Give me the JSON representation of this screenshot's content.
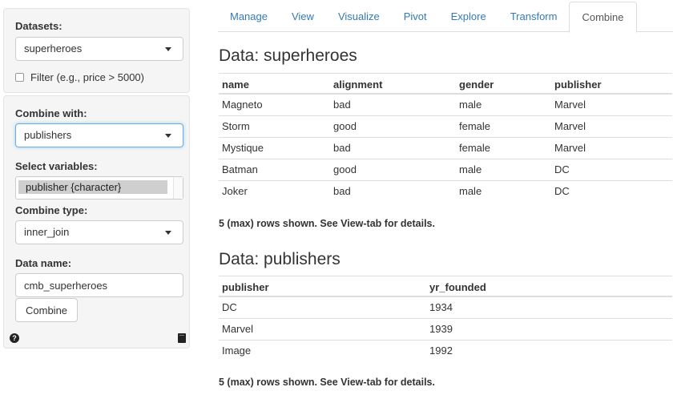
{
  "sidebar": {
    "datasets_label": "Datasets:",
    "dataset_selected": "superheroes",
    "filter_label": "Filter (e.g., price > 5000)",
    "combine_with_label": "Combine with:",
    "combine_with_selected": "publishers",
    "select_variables_label": "Select variables:",
    "variables_options": [
      "publisher {character}"
    ],
    "combine_type_label": "Combine type:",
    "combine_type_selected": "inner_join",
    "data_name_label": "Data name:",
    "data_name_value": "cmb_superheroes",
    "combine_button": "Combine",
    "help_icon_glyph": "?"
  },
  "tabs": [
    {
      "label": "Manage",
      "active": false
    },
    {
      "label": "View",
      "active": false
    },
    {
      "label": "Visualize",
      "active": false
    },
    {
      "label": "Pivot",
      "active": false
    },
    {
      "label": "Explore",
      "active": false
    },
    {
      "label": "Transform",
      "active": false
    },
    {
      "label": "Combine",
      "active": true
    }
  ],
  "main": {
    "table1": {
      "title": "Data: superheroes",
      "columns": [
        "name",
        "alignment",
        "gender",
        "publisher"
      ],
      "rows": [
        [
          "Magneto",
          "bad",
          "male",
          "Marvel"
        ],
        [
          "Storm",
          "good",
          "female",
          "Marvel"
        ],
        [
          "Mystique",
          "bad",
          "female",
          "Marvel"
        ],
        [
          "Batman",
          "good",
          "male",
          "DC"
        ],
        [
          "Joker",
          "bad",
          "male",
          "DC"
        ]
      ],
      "note": "5 (max) rows shown. See View-tab for details."
    },
    "table2": {
      "title": "Data: publishers",
      "columns": [
        "publisher",
        "yr_founded"
      ],
      "rows": [
        [
          "DC",
          "1934"
        ],
        [
          "Marvel",
          "1939"
        ],
        [
          "Image",
          "1992"
        ]
      ],
      "note": "5 (max) rows shown. See View-tab for details."
    }
  }
}
